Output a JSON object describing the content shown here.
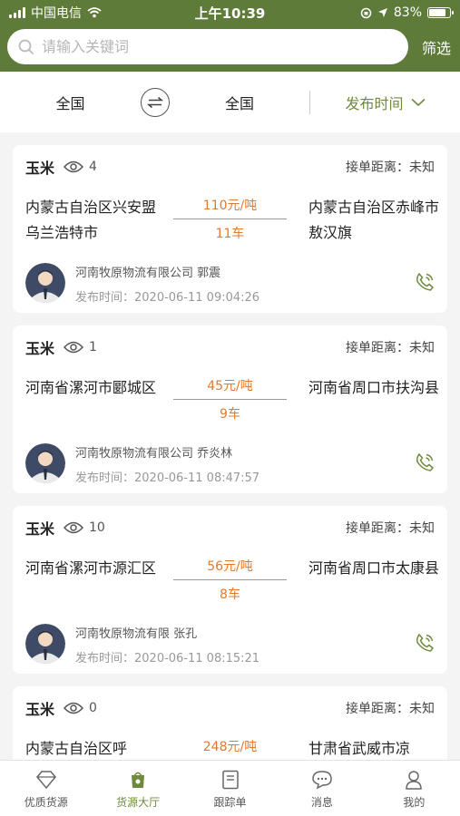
{
  "status_bar": {
    "carrier": "中国电信",
    "time": "上午10:39",
    "battery": "83%",
    "battery_level": 0.83
  },
  "search": {
    "placeholder": "请输入关键词",
    "value": "",
    "filter_label": "筛选"
  },
  "filter_bar": {
    "origin": "全国",
    "destination": "全国",
    "sort_label": "发布时间"
  },
  "listings": [
    {
      "cargo": "玉米",
      "views": "4",
      "distance": "接单距离：未知",
      "origin": "内蒙古自治区兴安盟乌兰浩特市",
      "destination": "内蒙古自治区赤峰市敖汉旗",
      "price": "110元/吨",
      "count": "11车",
      "company": "河南牧原物流有限公司  郭震",
      "time": "发布时间：2020-06-11 09:04:26"
    },
    {
      "cargo": "玉米",
      "views": "1",
      "distance": "接单距离：未知",
      "origin": "河南省漯河市郾城区",
      "destination": "河南省周口市扶沟县",
      "price": "45元/吨",
      "count": "9车",
      "company": "河南牧原物流有限公司  乔炎林",
      "time": "发布时间：2020-06-11 08:47:57"
    },
    {
      "cargo": "玉米",
      "views": "10",
      "distance": "接单距离：未知",
      "origin": "河南省漯河市源汇区",
      "destination": "河南省周口市太康县",
      "price": "56元/吨",
      "count": "8车",
      "company": "河南牧原物流有限  张孔",
      "time": "发布时间：2020-06-11 08:15:21"
    },
    {
      "cargo": "玉米",
      "views": "0",
      "distance": "接单距离：未知",
      "origin": "内蒙古自治区呼",
      "destination": "甘肃省武威市凉",
      "price": "248元/吨",
      "count": "",
      "company": "",
      "time": ""
    }
  ],
  "tabs": [
    {
      "label": "优质货源",
      "icon": "diamond-icon"
    },
    {
      "label": "货源大厅",
      "icon": "shop-bag-icon"
    },
    {
      "label": "跟踪单",
      "icon": "document-icon"
    },
    {
      "label": "消息",
      "icon": "chat-bubble-icon"
    },
    {
      "label": "我的",
      "icon": "user-icon"
    }
  ],
  "colors": {
    "header": "#5e7b3a",
    "accent": "#6f8a3c",
    "price": "#e07a2f"
  }
}
